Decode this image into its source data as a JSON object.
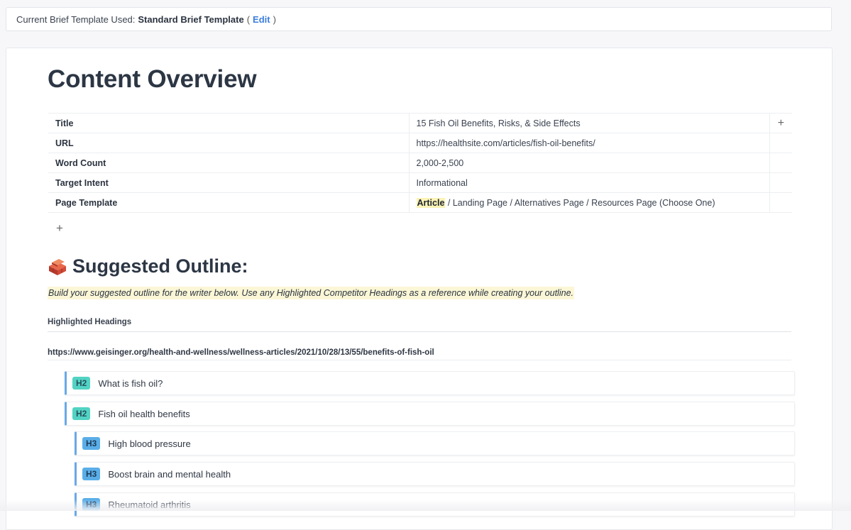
{
  "topbar": {
    "prefix": "Current Brief Template Used:",
    "template_name": "Standard Brief Template",
    "paren_open": "(",
    "edit_label": "Edit",
    "paren_close": ")"
  },
  "overview": {
    "title": "Content Overview",
    "rows": [
      {
        "key": "Title",
        "value": "15 Fish Oil Benefits, Risks, & Side Effects"
      },
      {
        "key": "URL",
        "value": "https://healthsite.com/articles/fish-oil-benefits/"
      },
      {
        "key": "Word Count",
        "value": "2,000-2,500"
      },
      {
        "key": "Target Intent",
        "value": "Informational"
      },
      {
        "key": "Page Template",
        "value_highlight": "Article",
        "value_rest": " / Landing Page / Alternatives Page / Resources Page (Choose One)"
      }
    ],
    "add_column_icon": "+",
    "add_row_icon": "+"
  },
  "outline": {
    "icon": "brick-icon",
    "heading": "Suggested Outline:",
    "instruction": "Build your suggested outline for the writer below. Use any Highlighted Competitor Headings as a reference while creating your outline.",
    "highlighted_label": "Highlighted Headings",
    "source_url": "https://www.geisinger.org/health-and-wellness/wellness-articles/2021/10/28/13/55/benefits-of-fish-oil",
    "headings": [
      {
        "level": "H2",
        "text": "What is fish oil?"
      },
      {
        "level": "H2",
        "text": "Fish oil health benefits"
      },
      {
        "level": "H3",
        "text": "High blood pressure"
      },
      {
        "level": "H3",
        "text": "Boost brain and mental health"
      },
      {
        "level": "H3",
        "text": "Rheumatoid arthritis"
      }
    ]
  },
  "colors": {
    "h2_badge": "#52d3c3",
    "h3_badge": "#5aaee8",
    "accent_border": "#69a9e6",
    "edit_link": "#3b7ddd",
    "highlight": "#fbf3b5"
  }
}
